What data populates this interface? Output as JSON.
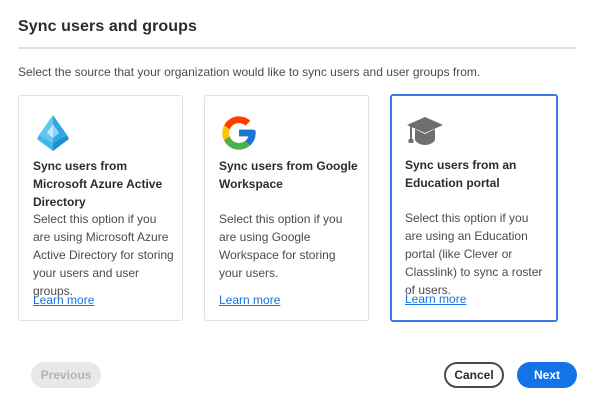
{
  "dialog": {
    "title": "Sync users and groups",
    "subtitle": "Select the source that your organization would like to sync users and user groups from."
  },
  "cards": [
    {
      "icon": "azure-active-directory-icon",
      "title": "Sync users from Microsoft Azure Active Directory",
      "description": "Select this option if you are using Microsoft Azure Active Directory for storing your users and user groups.",
      "link": "Learn more",
      "selected": false
    },
    {
      "icon": "google-icon",
      "title": "Sync users from Google Workspace",
      "description": "Select this option if you are using Google Workspace for storing your users.",
      "link": "Learn more",
      "selected": false
    },
    {
      "icon": "graduation-cap-icon",
      "title": "Sync users from an Education portal",
      "description": "Select this option if you are using an Education portal (like Clever or Classlink) to sync a roster of users.",
      "link": "Learn more",
      "selected": true
    }
  ],
  "footer": {
    "previous_label": "Previous",
    "cancel_label": "Cancel",
    "next_label": "Next"
  },
  "colors": {
    "accent": "#1473e6",
    "selected_border": "#3b78e7",
    "disabled_bg": "#e8e8e8"
  }
}
